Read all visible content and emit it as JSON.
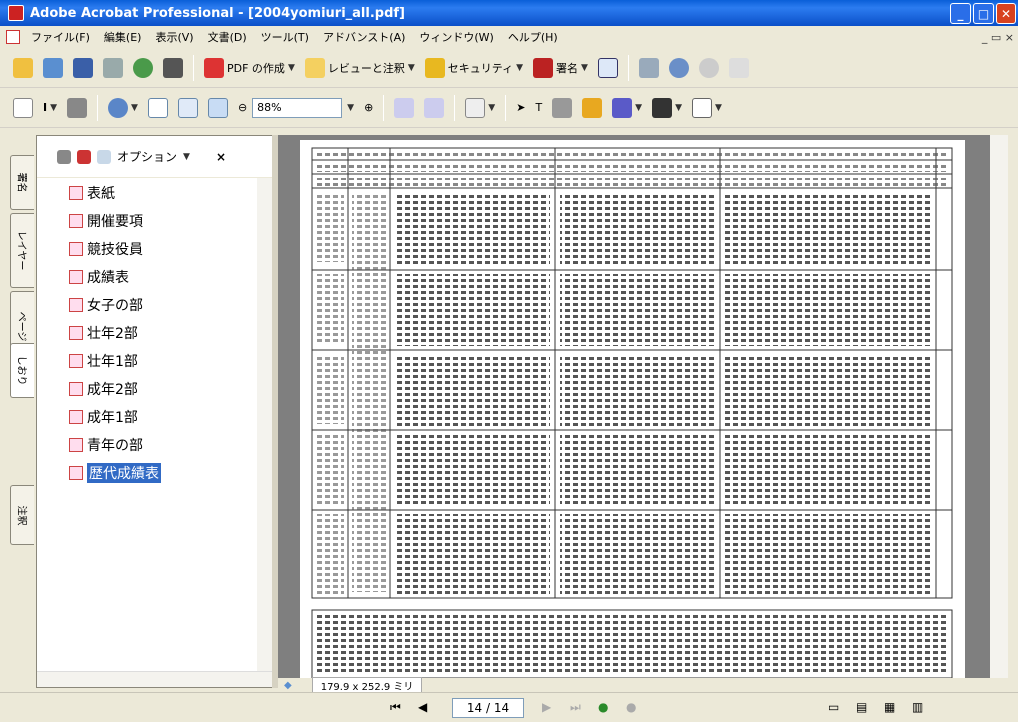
{
  "window": {
    "title": "Adobe Acrobat Professional - [2004yomiuri_all.pdf]"
  },
  "menu": {
    "items": [
      "ファイル(F)",
      "編集(E)",
      "表示(V)",
      "文書(D)",
      "ツール(T)",
      "アドバンスト(A)",
      "ウィンドウ(W)",
      "ヘルプ(H)"
    ],
    "mdi": "_ 𝗘 ×"
  },
  "toolbar1": {
    "pdf_create": "PDF の作成",
    "review": "レビューと注釈",
    "security": "セキュリティ",
    "sign": "署名"
  },
  "toolbar2": {
    "zoom": "88%"
  },
  "sidetabs": [
    "署名",
    "レイヤー",
    "ページ",
    "しおり",
    "注釈"
  ],
  "panel": {
    "options": "オプション",
    "close": "×"
  },
  "bookmarks": [
    "表紙",
    "開催要項",
    "競技役員",
    "成績表",
    "女子の部",
    "壮年2部",
    "壮年1部",
    "成年2部",
    "成年1部",
    "青年の部",
    "歴代成績表"
  ],
  "selected_bookmark": "歴代成績表",
  "status": {
    "page_size": "179.9 x 252.9 ミリ"
  },
  "nav": {
    "page": "14 / 14"
  }
}
